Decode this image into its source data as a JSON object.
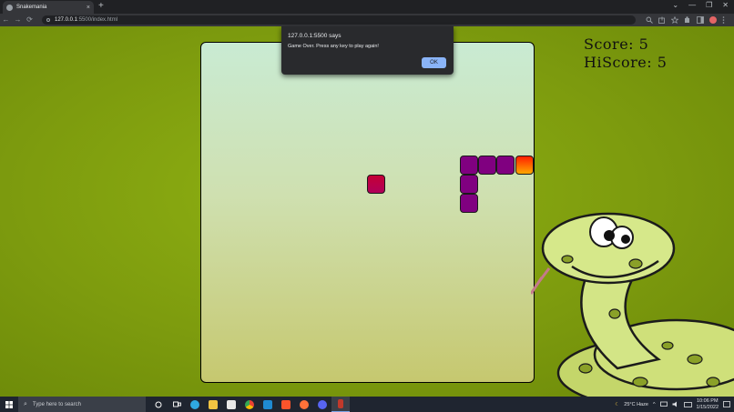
{
  "browser": {
    "tab_title": "Snakemania",
    "tab_close": "×",
    "new_tab": "+",
    "window_controls": [
      "⌄",
      "—",
      "❐",
      "✕"
    ],
    "nav": {
      "back": "←",
      "forward": "→",
      "reload": "⟳"
    },
    "url_host": "127.0.0.1",
    "url_path": ":5500/index.html"
  },
  "game": {
    "score_label": "Score: 5",
    "hiscore_label": "HiScore: 5",
    "snake_color": "#800080",
    "food_color": "#c40035"
  },
  "alert": {
    "origin": "127.0.0.1:5500 says",
    "message": "Game Over. Press any key to play again!",
    "ok_label": "OK"
  },
  "taskbar": {
    "search_placeholder": "Type here to search",
    "weather": "25°C  Haze",
    "time": "10:06 PM",
    "date": "1/15/2022"
  }
}
